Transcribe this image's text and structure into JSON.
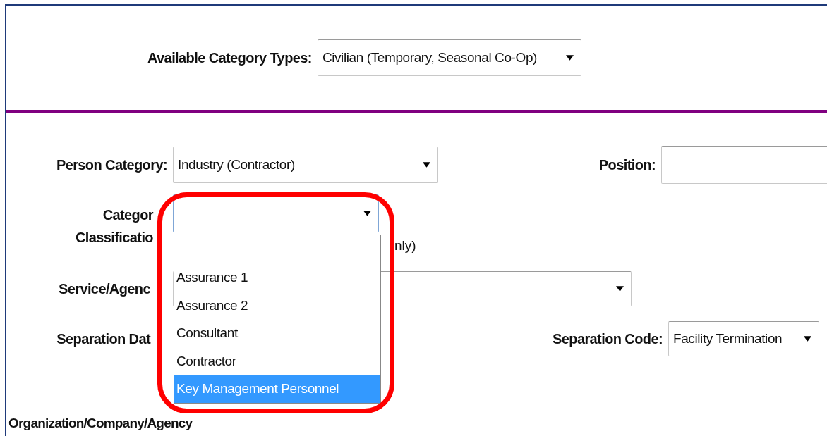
{
  "category_types": {
    "label": "Available Category Types:",
    "value": "Civilian (Temporary, Seasonal Co-Op)"
  },
  "person_category": {
    "label": "Person Category:",
    "value": "Industry (Contractor)"
  },
  "position": {
    "label": "Position:"
  },
  "category_classification": {
    "label_lines": [
      "Categor",
      "Classificatio"
    ],
    "expanded": true,
    "note": "nly)",
    "options": [
      {
        "label": "Assurance 1",
        "selected": false
      },
      {
        "label": "Assurance 2",
        "selected": false
      },
      {
        "label": "Consultant",
        "selected": false
      },
      {
        "label": "Contractor",
        "selected": false
      },
      {
        "label": "Key Management Personnel",
        "selected": true
      }
    ]
  },
  "service_agency": {
    "label": "Service/Agenc"
  },
  "separation_date": {
    "label": "Separation Dat"
  },
  "separation_code": {
    "label": "Separation Code:",
    "value": "Facility Termination"
  },
  "section_heading": "Organization/Company/Agency"
}
